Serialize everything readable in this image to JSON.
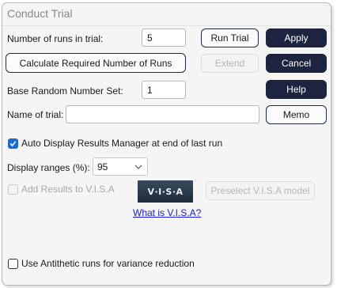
{
  "dialog": {
    "title": "Conduct Trial"
  },
  "runs": {
    "label": "Number of runs in trial:",
    "value": "5"
  },
  "buttons": {
    "run_trial": "Run Trial",
    "apply": "Apply",
    "calculate": "Calculate Required Number of Runs",
    "extend": "Extend",
    "cancel": "Cancel",
    "help": "Help",
    "memo": "Memo",
    "preselect": "Preselect V.I.S.A model"
  },
  "random_set": {
    "label": "Base Random Number Set:",
    "value": "1"
  },
  "trial_name": {
    "label": "Name of trial:",
    "value": ""
  },
  "auto_display": {
    "label": "Auto Display Results Manager at end of last run",
    "checked": true
  },
  "display_ranges": {
    "label": "Display ranges (%):",
    "selected": "95"
  },
  "add_results": {
    "label": "Add Results to V.I.S.A",
    "checked": false,
    "enabled": false
  },
  "visa": {
    "logo_text": "V·I·S·A",
    "link": "What is V.I.S.A?"
  },
  "antithetic": {
    "label": "Use Antithetic runs for variance reduction",
    "checked": false
  },
  "colors": {
    "dark_button": "#1c2440",
    "checkbox_on": "#1f6ad1",
    "link": "#1a1ae0"
  }
}
